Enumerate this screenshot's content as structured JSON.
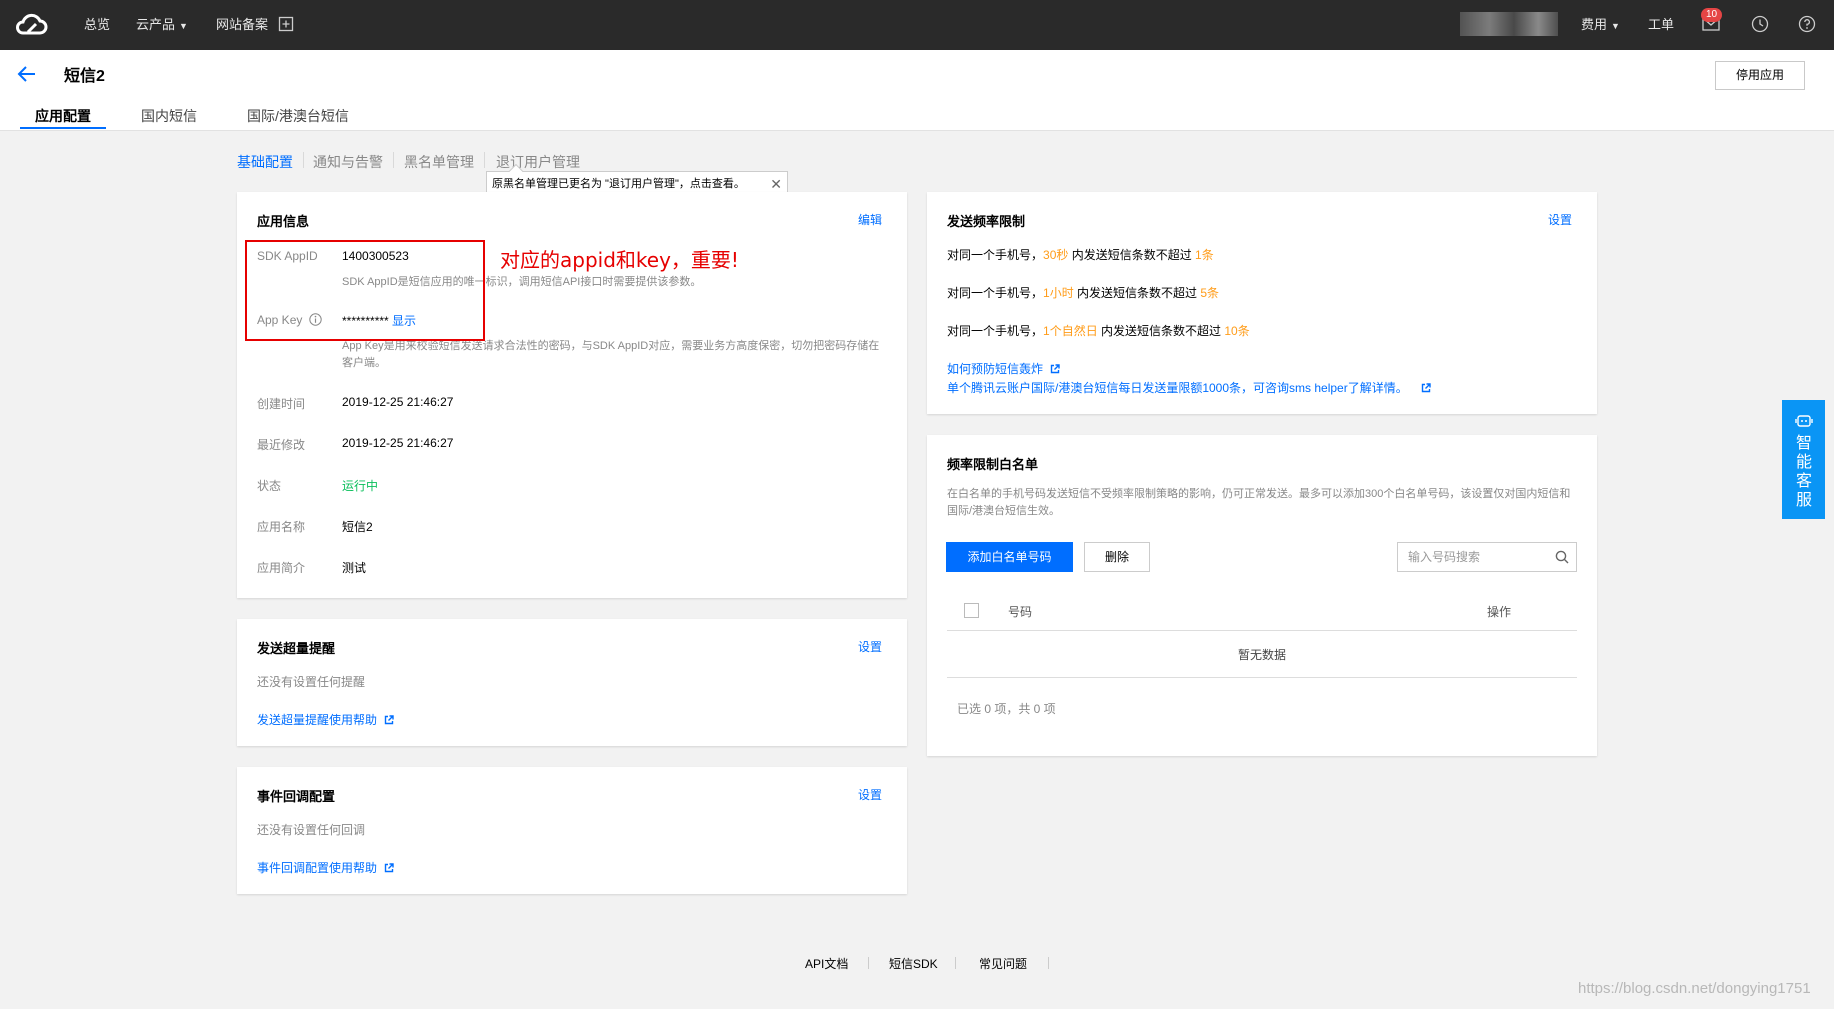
{
  "topnav": {
    "items": [
      "总览",
      "云产品",
      "网站备案"
    ],
    "right": {
      "fees": "费用",
      "tickets": "工单",
      "message_count": "10"
    }
  },
  "header": {
    "title": "短信2",
    "stop_button": "停用应用",
    "tabs": [
      "应用配置",
      "国内短信",
      "国际/港澳台短信"
    ]
  },
  "subtabs": {
    "items": [
      "基础配置",
      "通知与告警",
      "黑名单管理",
      "退订用户管理"
    ],
    "tooltip": "原黑名单管理已更名为 \"退订用户管理\"，点击查看。"
  },
  "app_info": {
    "title": "应用信息",
    "edit": "编辑",
    "sdk_appid_label": "SDK AppID",
    "sdk_appid_value": "1400300523",
    "sdk_appid_desc": "SDK AppID是短信应用的唯一标识，调用短信API接口时需要提供该参数。",
    "appkey_label": "App Key",
    "appkey_value": "**********",
    "appkey_show": "显示",
    "appkey_desc": "App Key是用来校验短信发送请求合法性的密码，与SDK AppID对应，需要业务方高度保密，切勿把密码存储在客户端。",
    "created_label": "创建时间",
    "created_value": "2019-12-25 21:46:27",
    "modified_label": "最近修改",
    "modified_value": "2019-12-25 21:46:27",
    "status_label": "状态",
    "status_value": "运行中",
    "name_label": "应用名称",
    "name_value": "短信2",
    "intro_label": "应用简介",
    "intro_value": "测试",
    "annotation": "对应的appid和key，重要!"
  },
  "overuse": {
    "title": "发送超量提醒",
    "setting": "设置",
    "empty": "还没有设置任何提醒",
    "help": "发送超量提醒使用帮助"
  },
  "callback": {
    "title": "事件回调配置",
    "setting": "设置",
    "empty": "还没有设置任何回调",
    "help": "事件回调配置使用帮助"
  },
  "rate_limit": {
    "title": "发送频率限制",
    "setting": "设置",
    "rows": [
      {
        "prefix": "对同一个手机号，",
        "period": "30秒",
        "middle": " 内发送短信条数不超过 ",
        "count": "1条"
      },
      {
        "prefix": "对同一个手机号，",
        "period": "1小时",
        "middle": " 内发送短信条数不超过 ",
        "count": "5条"
      },
      {
        "prefix": "对同一个手机号，",
        "period": "1个自然日",
        "middle": " 内发送短信条数不超过 ",
        "count": "10条"
      }
    ],
    "link1": "如何预防短信轰炸",
    "link2": "单个腾讯云账户国际/港澳台短信每日发送量限额1000条，可咨询sms helper了解详情。"
  },
  "whitelist": {
    "title": "频率限制白名单",
    "desc": "在白名单的手机号码发送短信不受频率限制策略的影响，仍可正常发送。最多可以添加300个白名单号码，该设置仅对国内短信和国际/港澳台短信生效。",
    "add_button": "添加白名单号码",
    "delete_button": "删除",
    "search_placeholder": "输入号码搜索",
    "col_number": "号码",
    "col_action": "操作",
    "empty": "暂无数据",
    "summary": "已选 0 项，共 0 项"
  },
  "footer": {
    "links": [
      "API文档",
      "短信SDK",
      "常见问题"
    ],
    "watermark": "https://blog.csdn.net/dongying1751"
  },
  "float_service": {
    "label": "智能客服"
  },
  "colors": {
    "accent": "#006eff",
    "success": "#0abf5b",
    "warning": "#ff9c19",
    "annotation": "#e60000"
  }
}
